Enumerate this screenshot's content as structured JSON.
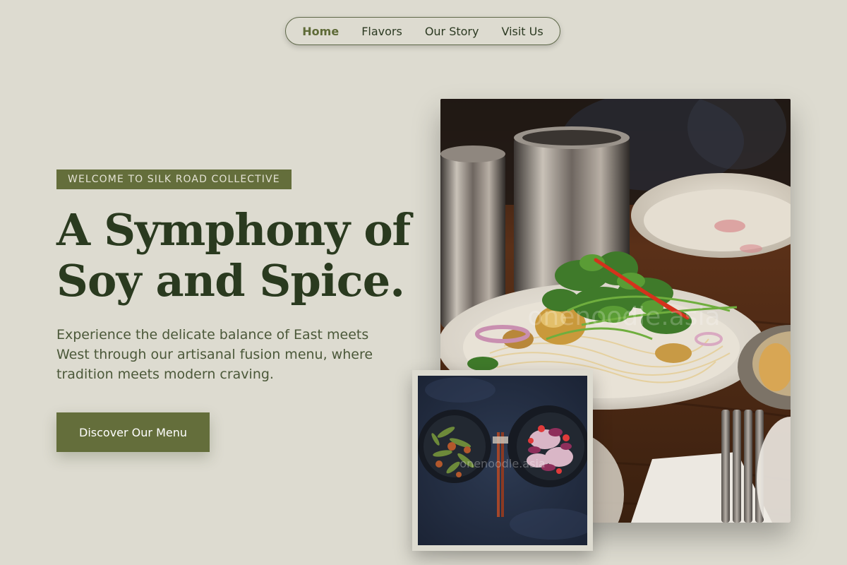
{
  "nav": {
    "items": [
      {
        "label": "Home",
        "active": true
      },
      {
        "label": "Flavors",
        "active": false
      },
      {
        "label": "Our Story",
        "active": false
      },
      {
        "label": "Visit Us",
        "active": false
      }
    ]
  },
  "hero": {
    "badge": "WELCOME TO SILK ROAD COLLECTIVE",
    "headline_lines": [
      "A Symphony of",
      "Soy and Spice."
    ],
    "subtitle_lines": [
      "Experience the delicate balance of East meets",
      "West through our artisanal fusion menu, where",
      "tradition meets modern craving."
    ],
    "cta_label": "Discover Our Menu"
  },
  "images": {
    "main_alt": "Plate of glass noodle salad with herbs, chili strips and crispy tofu beside metal cups on a wooden table",
    "main_watermark": "onenoodle.asia",
    "inset_alt": "Two dark bowls of stir-fried dishes with chopsticks between them on a dark slate surface",
    "inset_watermark": "onenoodle.asia"
  },
  "colors": {
    "background": "#dddbd0",
    "accent_olive": "#646e3b",
    "heading_green": "#2a3a1f",
    "body_text": "#4b5839"
  }
}
